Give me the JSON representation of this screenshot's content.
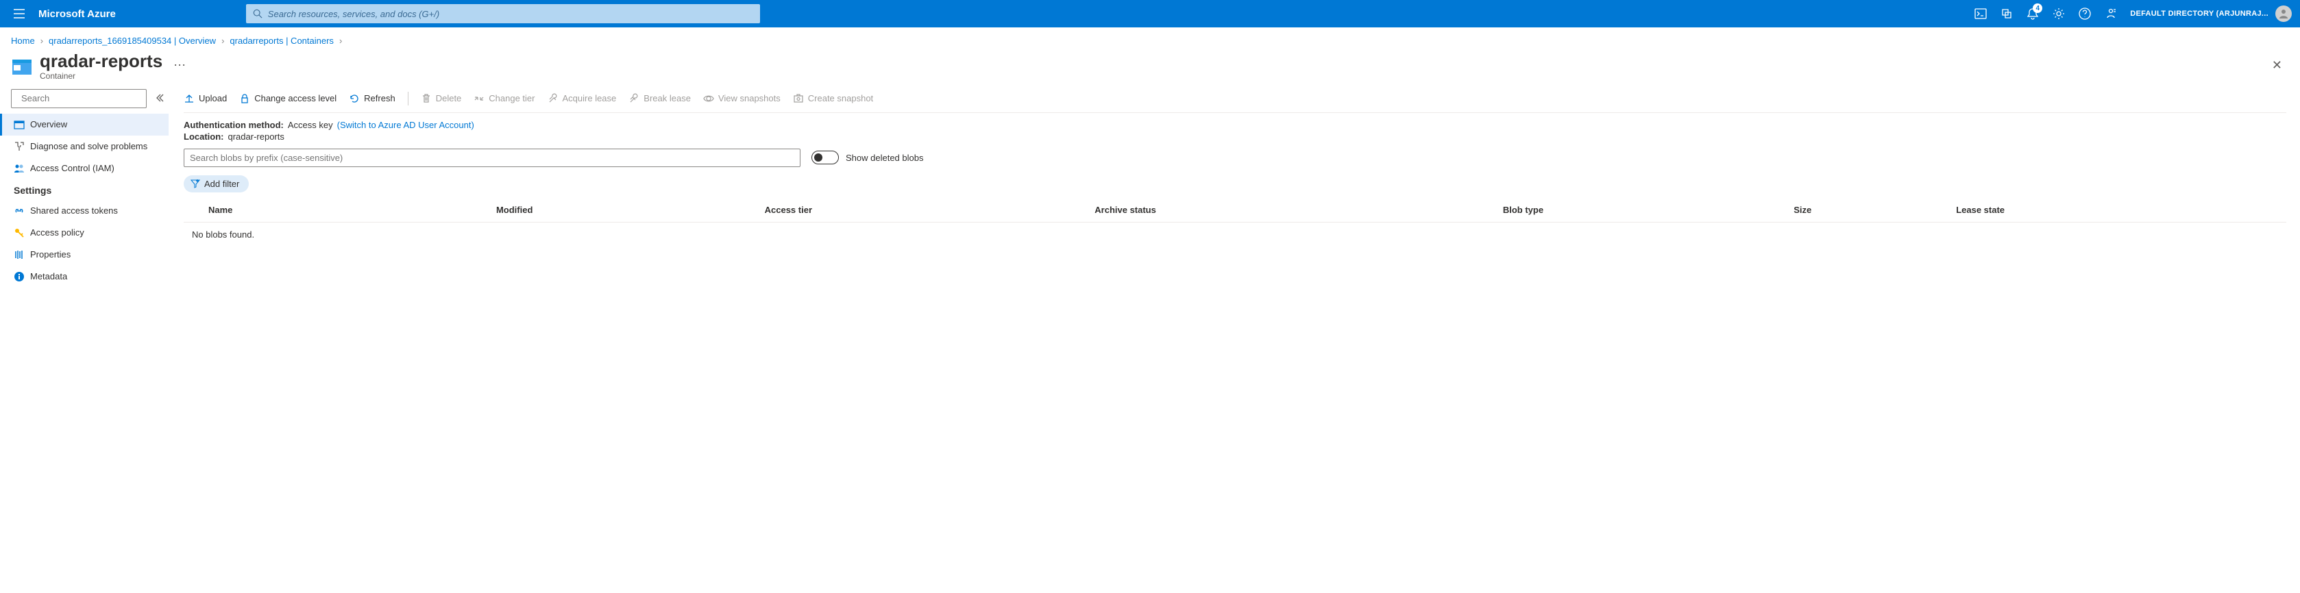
{
  "header": {
    "brand": "Microsoft Azure",
    "search_placeholder": "Search resources, services, and docs (G+/)",
    "notification_count": "4",
    "user_label": "DEFAULT DIRECTORY (ARJUNRAJ..."
  },
  "breadcrumb": {
    "items": [
      {
        "label": "Home"
      },
      {
        "label": "qradarreports_1669185409534 | Overview"
      },
      {
        "label": "qradarreports | Containers"
      }
    ]
  },
  "page": {
    "title": "qradar-reports",
    "subtitle": "Container"
  },
  "sidebar": {
    "search_placeholder": "Search",
    "items_top": [
      {
        "label": "Overview",
        "active": true
      },
      {
        "label": "Diagnose and solve problems",
        "active": false
      },
      {
        "label": "Access Control (IAM)",
        "active": false
      }
    ],
    "settings_header": "Settings",
    "items_settings": [
      {
        "label": "Shared access tokens"
      },
      {
        "label": "Access policy"
      },
      {
        "label": "Properties"
      },
      {
        "label": "Metadata"
      }
    ]
  },
  "toolbar": {
    "upload": "Upload",
    "change_level": "Change access level",
    "refresh": "Refresh",
    "delete": "Delete",
    "change_tier": "Change tier",
    "acquire_lease": "Acquire lease",
    "break_lease": "Break lease",
    "view_snapshots": "View snapshots",
    "create_snapshot": "Create snapshot"
  },
  "meta": {
    "auth_label": "Authentication method:",
    "auth_value": "Access key",
    "auth_switch": "(Switch to Azure AD User Account)",
    "location_label": "Location:",
    "location_value": "qradar-reports"
  },
  "filters": {
    "blob_search_placeholder": "Search blobs by prefix (case-sensitive)",
    "show_deleted_label": "Show deleted blobs",
    "add_filter_label": "Add filter"
  },
  "table": {
    "columns": [
      "Name",
      "Modified",
      "Access tier",
      "Archive status",
      "Blob type",
      "Size",
      "Lease state"
    ],
    "empty_text": "No blobs found."
  }
}
